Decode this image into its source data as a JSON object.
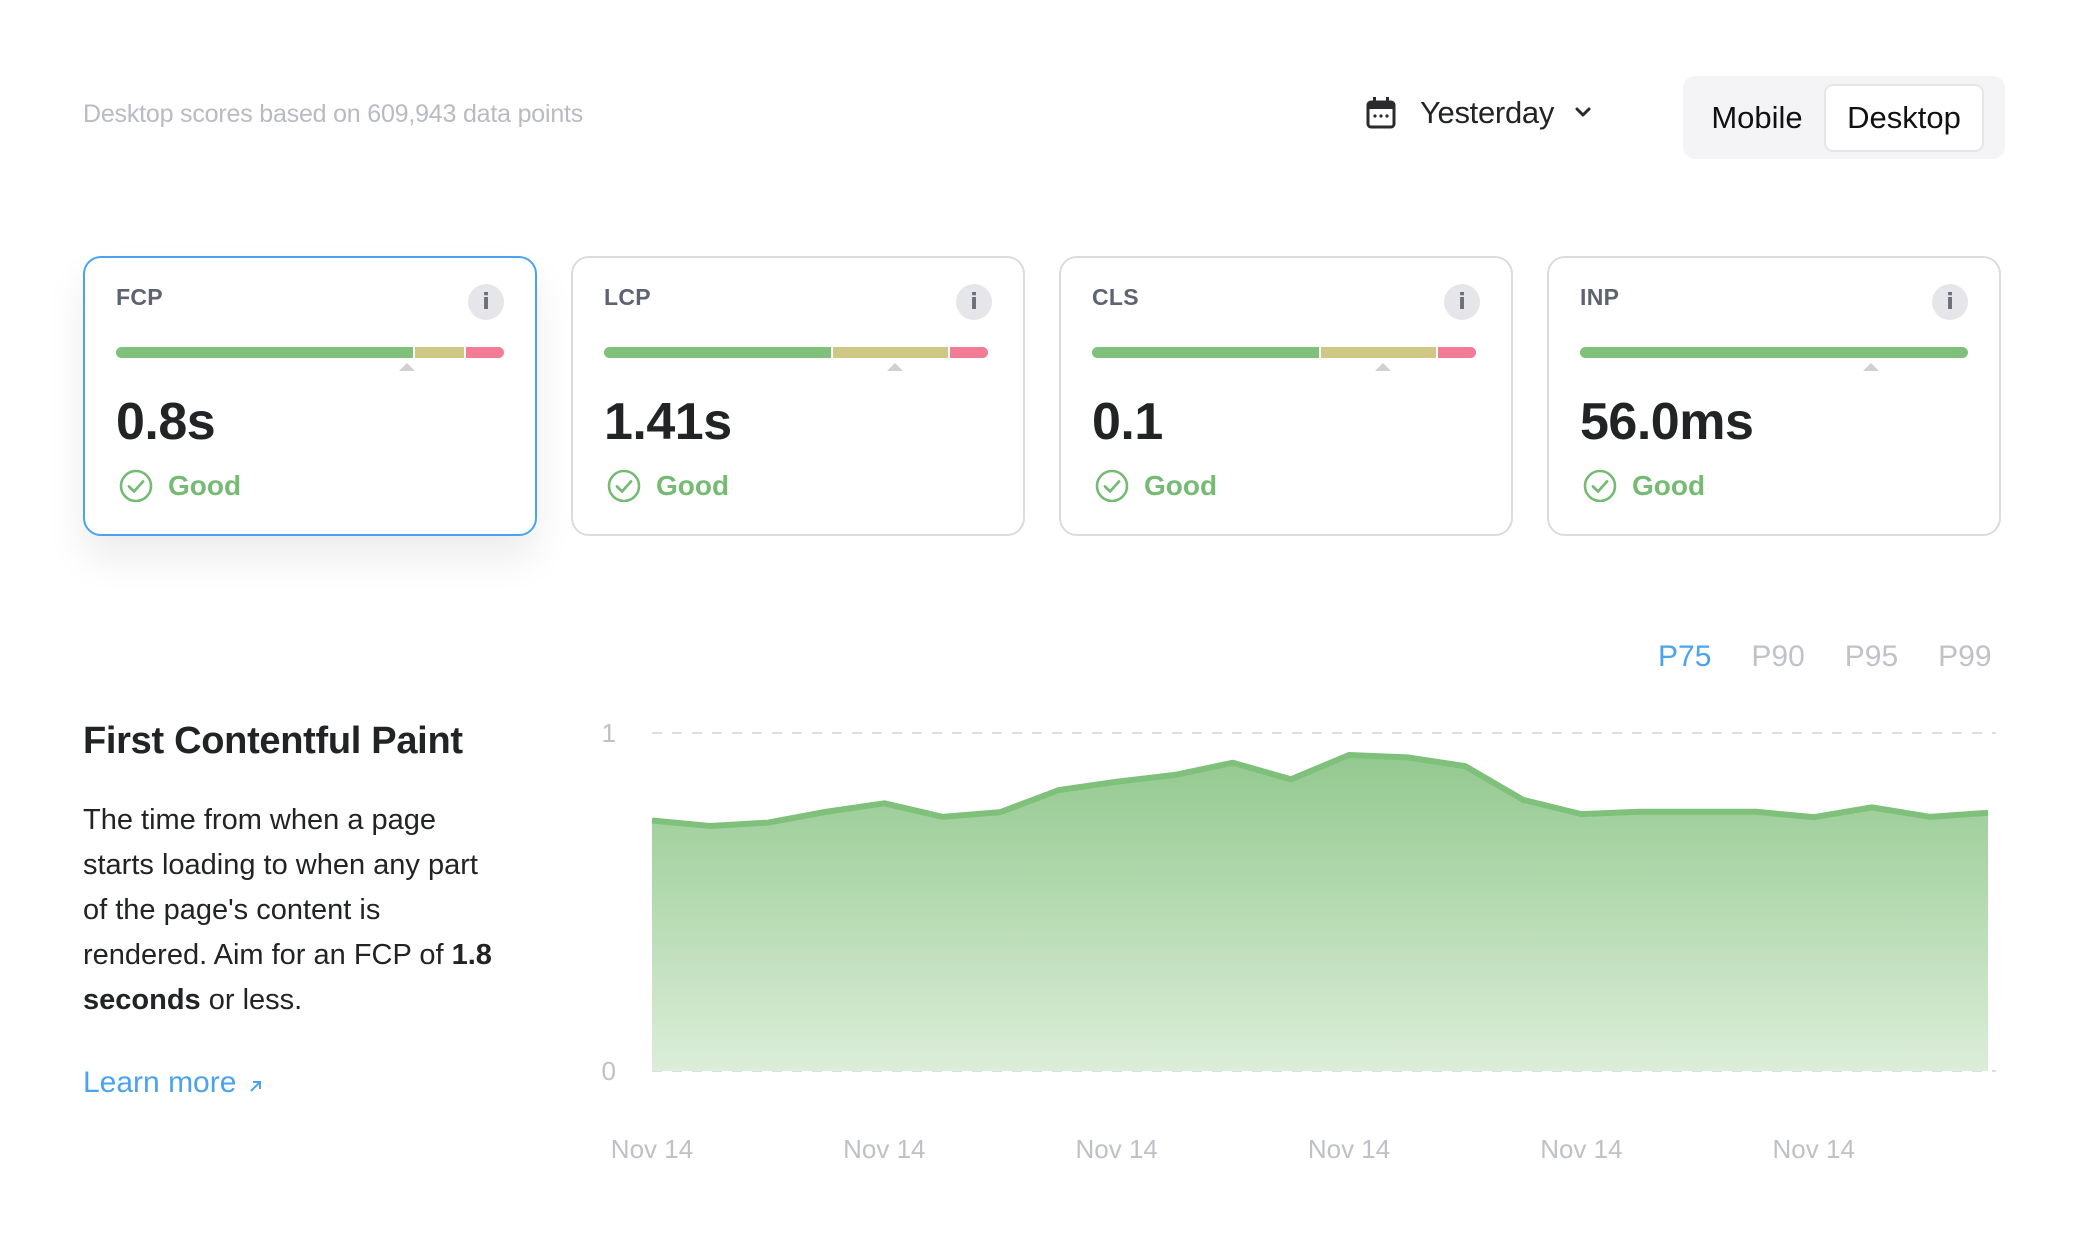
{
  "header": {
    "subtitle": "Desktop scores based on 609,943 data points",
    "date_range": {
      "icon": "calendar-icon",
      "label": "Yesterday",
      "chevron": "chevron-down-icon"
    },
    "device_toggle": {
      "options": [
        "Mobile",
        "Desktop"
      ],
      "selected": "Desktop"
    }
  },
  "colors": {
    "good": "#7fc07b",
    "needs_improvement": "#cfc884",
    "poor": "#f27b95",
    "accent": "#4ba3ef",
    "good_text": "#76bb74"
  },
  "metrics": [
    {
      "name": "FCP",
      "value": "0.8s",
      "status": "Good",
      "active": true,
      "distribution": {
        "good": 0.79,
        "needs_improvement": 0.13,
        "poor": 0.1
      },
      "marker_position": 0.75
    },
    {
      "name": "LCP",
      "value": "1.41s",
      "status": "Good",
      "active": false,
      "distribution": {
        "good": 0.59,
        "needs_improvement": 0.3,
        "poor": 0.1
      },
      "marker_position": 0.75
    },
    {
      "name": "CLS",
      "value": "0.1",
      "status": "Good",
      "active": false,
      "distribution": {
        "good": 0.59,
        "needs_improvement": 0.3,
        "poor": 0.1
      },
      "marker_position": 0.75
    },
    {
      "name": "INP",
      "value": "56.0ms",
      "status": "Good",
      "active": false,
      "distribution": {
        "good": 1.0,
        "needs_improvement": 0.0,
        "poor": 0.0
      },
      "marker_position": 0.75
    }
  ],
  "detail": {
    "title": "First Contentful Paint",
    "description_plain": "The time from when a page starts loading to when any part of the page's content is rendered. Aim for an FCP of ",
    "description_bold": "1.8 seconds",
    "description_end": " or less.",
    "learn_more": "Learn more",
    "learn_more_icon": "arrow-up-right-icon"
  },
  "percentiles": {
    "options": [
      "P75",
      "P90",
      "P95",
      "P99"
    ],
    "selected": "P75"
  },
  "chart_data": {
    "type": "area",
    "title": "First Contentful Paint",
    "xlabel": "",
    "ylabel": "",
    "ylim": [
      0,
      1
    ],
    "yticks": [
      "0",
      "1"
    ],
    "x_tick_labels": [
      "Nov 14",
      "Nov 14",
      "Nov 14",
      "Nov 14",
      "Nov 14",
      "Nov 14"
    ],
    "grid": true,
    "series": [
      {
        "name": "P75",
        "values": [
          0.741,
          0.725,
          0.735,
          0.767,
          0.792,
          0.752,
          0.766,
          0.831,
          0.856,
          0.876,
          0.912,
          0.863,
          0.935,
          0.928,
          0.902,
          0.802,
          0.76,
          0.767,
          0.767,
          0.767,
          0.751,
          0.78,
          0.752,
          0.764
        ]
      }
    ]
  }
}
